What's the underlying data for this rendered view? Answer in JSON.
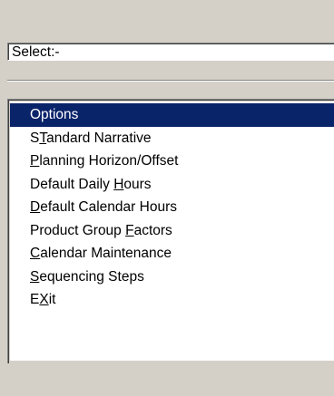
{
  "select": {
    "label": "Select:-"
  },
  "menu": {
    "items": [
      {
        "pre": "Options",
        "key": "",
        "post": "",
        "selected": true
      },
      {
        "pre": "S",
        "key": "T",
        "post": "andard Narrative",
        "selected": false
      },
      {
        "pre": "",
        "key": "P",
        "post": "lanning Horizon/Offset",
        "selected": false
      },
      {
        "pre": "Default Daily ",
        "key": "H",
        "post": "ours",
        "selected": false
      },
      {
        "pre": "",
        "key": "D",
        "post": "efault Calendar Hours",
        "selected": false
      },
      {
        "pre": "Product Group ",
        "key": "F",
        "post": "actors",
        "selected": false
      },
      {
        "pre": "",
        "key": "C",
        "post": "alendar Maintenance",
        "selected": false
      },
      {
        "pre": "",
        "key": "S",
        "post": "equencing Steps",
        "selected": false
      },
      {
        "pre": "E",
        "key": "X",
        "post": "it",
        "selected": false
      }
    ]
  },
  "colors": {
    "window_bg": "#d4d0c8",
    "selection_bg": "#0a246a",
    "selection_fg": "#ffffff"
  }
}
